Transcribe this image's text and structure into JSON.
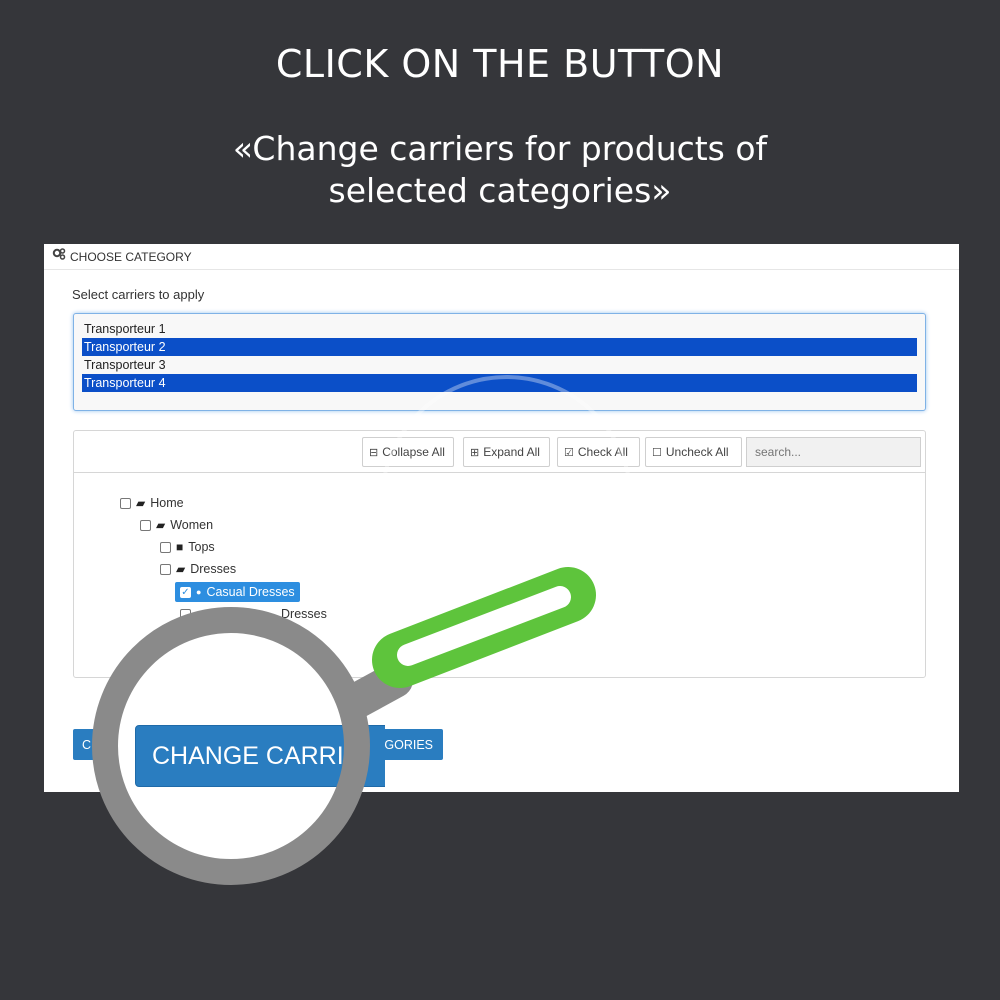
{
  "headline": {
    "line1": "CLICK ON THE BUTTON",
    "line2": "«Change carriers for products of",
    "line3": "selected categories»"
  },
  "panel": {
    "header": "CHOOSE CATEGORY",
    "header_icon": "gears-icon",
    "carriers_label": "Select carriers to apply",
    "carriers": [
      {
        "label": "Transporteur 1",
        "selected": false
      },
      {
        "label": "Transporteur 2",
        "selected": true
      },
      {
        "label": "Transporteur 3",
        "selected": false
      },
      {
        "label": "Transporteur 4",
        "selected": true
      }
    ],
    "tree_toolbar": {
      "collapse_all": "Collapse All",
      "expand_all": "Expand All",
      "check_all": "Check All",
      "uncheck_all": "Uncheck All",
      "search_placeholder": "search..."
    },
    "tree": {
      "home": "Home",
      "women": "Women",
      "tops": "Tops",
      "dresses": "Dresses",
      "casual_dresses": "Casual Dresses",
      "partial_dresses": "Dresses"
    },
    "submit_visible_start": "C",
    "submit_visible_end": "ATEGORIES",
    "zoomed_submit": "CHANGE CARRIE"
  },
  "colors": {
    "background": "#35363a",
    "selection": "#0b4fc8",
    "button": "#2a7dc0",
    "magnifier_handle": "#5ec43c",
    "magnifier_ring": "#8a8a8a"
  }
}
